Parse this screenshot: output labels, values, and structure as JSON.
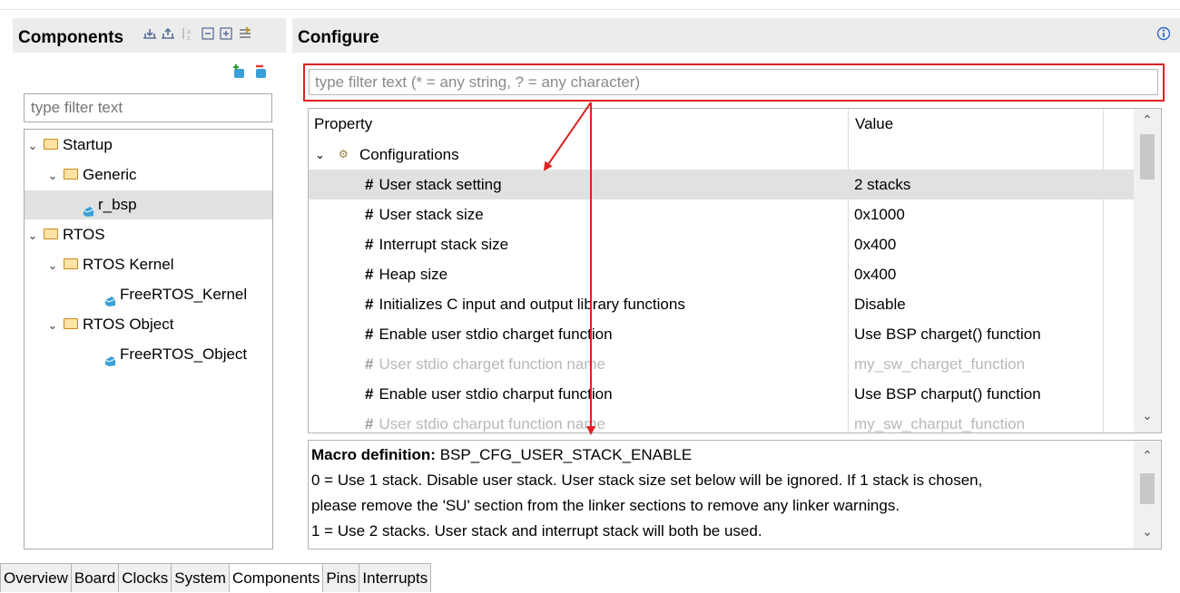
{
  "components_panel": {
    "title": "Components",
    "filter_placeholder": "type filter text",
    "tree": [
      {
        "label": "Startup",
        "type": "folder",
        "depth": 0
      },
      {
        "label": "Generic",
        "type": "folder",
        "depth": 1
      },
      {
        "label": "r_bsp",
        "type": "component",
        "depth": 2,
        "selected": true
      },
      {
        "label": "RTOS",
        "type": "folder",
        "depth": 0
      },
      {
        "label": "RTOS Kernel",
        "type": "folder",
        "depth": 1
      },
      {
        "label": "FreeRTOS_Kernel",
        "type": "component",
        "depth": 2
      },
      {
        "label": "RTOS Object",
        "type": "folder",
        "depth": 1
      },
      {
        "label": "FreeRTOS_Object",
        "type": "component",
        "depth": 2
      }
    ],
    "toolbar_icons": [
      "collapse-icon",
      "expand-icon",
      "sort-icon",
      "collapse-all-icon",
      "expand-all-icon",
      "filter-icon"
    ],
    "action_icons": [
      "add-component-icon",
      "remove-component-icon"
    ]
  },
  "configure_panel": {
    "title": "Configure",
    "info_icon": "info-icon",
    "filter_placeholder": "type filter text (* = any string, ? = any character)",
    "columns": {
      "property": "Property",
      "value": "Value"
    },
    "group_label": "Configurations",
    "properties": [
      {
        "name": "User stack setting",
        "value": "2 stacks",
        "selected": true,
        "disabled": false
      },
      {
        "name": "User stack size",
        "value": "0x1000",
        "disabled": false
      },
      {
        "name": "Interrupt stack size",
        "value": "0x400",
        "disabled": false
      },
      {
        "name": "Heap size",
        "value": "0x400",
        "disabled": false
      },
      {
        "name": "Initializes C input and output library functions",
        "value": "Disable",
        "disabled": false
      },
      {
        "name": "Enable user stdio charget function",
        "value": "Use BSP charget() function",
        "disabled": false
      },
      {
        "name": "User stdio charget function name",
        "value": "my_sw_charget_function",
        "disabled": true
      },
      {
        "name": "Enable user stdio charput function",
        "value": "Use BSP charput() function",
        "disabled": false
      },
      {
        "name": "User stdio charput function name",
        "value": "my_sw_charput_function",
        "disabled": true
      }
    ],
    "description": {
      "label": "Macro definition:",
      "macro": "BSP_CFG_USER_STACK_ENABLE",
      "lines": [
        "0 = Use 1 stack. Disable user stack. User stack size set below will be ignored. If 1 stack is chosen,",
        "please remove the 'SU' section from the linker sections to remove any linker warnings.",
        "1 = Use 2 stacks. User stack and interrupt stack will both be used."
      ]
    }
  },
  "bottom_tabs": [
    "Overview",
    "Board",
    "Clocks",
    "System",
    "Components",
    "Pins",
    "Interrupts"
  ],
  "active_tab": "Components",
  "colors": {
    "annotation_red": "#e02020",
    "selection": "#e1e1e1",
    "header_bg": "#ececec"
  }
}
